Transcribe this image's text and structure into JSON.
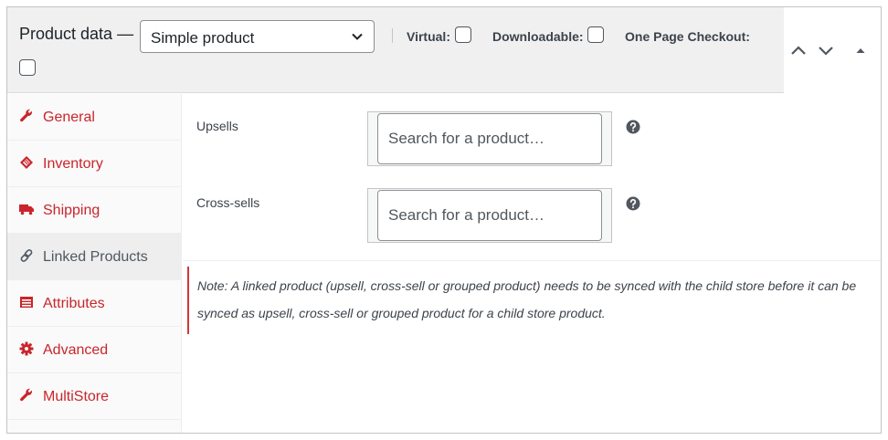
{
  "header": {
    "title": "Product data —",
    "product_type": "Simple product",
    "options": {
      "virtual_label": "Virtual:",
      "downloadable_label": "Downloadable:",
      "one_page_checkout_label": "One Page Checkout:"
    },
    "buttons": {
      "move_up_icon": "chevron-up-icon",
      "move_down_icon": "chevron-down-icon",
      "toggle_icon": "triangle-up-icon"
    }
  },
  "tabs": [
    {
      "label": "General",
      "icon": "wrench-icon"
    },
    {
      "label": "Inventory",
      "icon": "tag-icon"
    },
    {
      "label": "Shipping",
      "icon": "truck-icon"
    },
    {
      "label": "Linked Products",
      "icon": "link-icon",
      "active": true
    },
    {
      "label": "Attributes",
      "icon": "list-icon"
    },
    {
      "label": "Advanced",
      "icon": "gear-icon"
    },
    {
      "label": "MultiStore",
      "icon": "wrench-icon"
    }
  ],
  "fields": {
    "upsells": {
      "label": "Upsells",
      "placeholder": "Search for a product…"
    },
    "cross_sells": {
      "label": "Cross-sells",
      "placeholder": "Search for a product…"
    }
  },
  "note": "Note: A linked product (upsell, cross-sell or grouped product) needs to be synced with the child store before it can be synced as upsell, cross-sell or grouped product for a child store product.",
  "colors": {
    "accent": "#c9252c",
    "note_border": "#d63638",
    "header_bg": "#f0f0f1",
    "tab_bg": "#fafafa",
    "active_tab_bg": "#eeeeee"
  }
}
